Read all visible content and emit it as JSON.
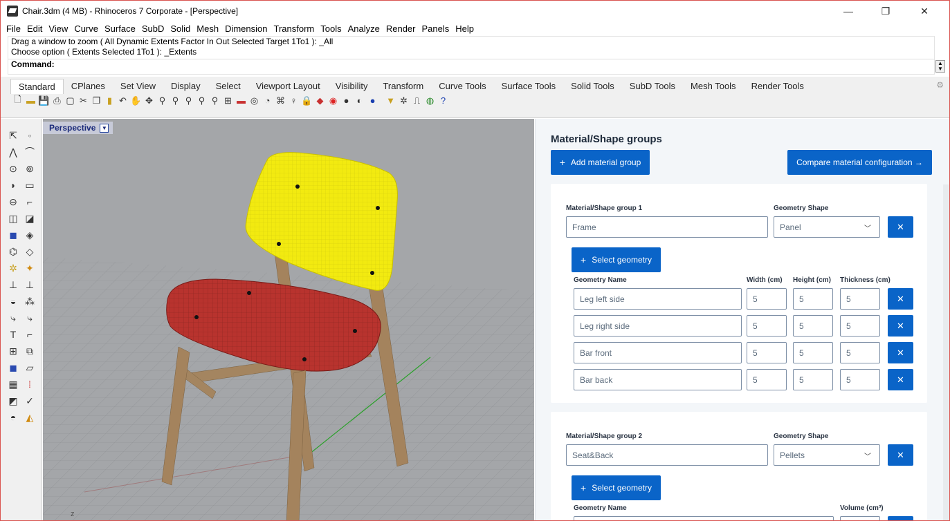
{
  "window": {
    "title": "Chair.3dm (4 MB) - Rhinoceros 7 Corporate - [Perspective]",
    "minimize": "—",
    "restore": "❐",
    "close": "✕"
  },
  "menu": [
    "File",
    "Edit",
    "View",
    "Curve",
    "Surface",
    "SubD",
    "Solid",
    "Mesh",
    "Dimension",
    "Transform",
    "Tools",
    "Analyze",
    "Render",
    "Panels",
    "Help"
  ],
  "command": {
    "history": [
      "Drag a window to zoom ( All  Dynamic  Extents  Factor  In  Out  Selected  Target  1To1 ): _All",
      "Choose option ( Extents  Selected  1To1 ): _Extents"
    ],
    "prompt": "Command:"
  },
  "toolbar_tabs": [
    "Standard",
    "CPlanes",
    "Set View",
    "Display",
    "Select",
    "Viewport Layout",
    "Visibility",
    "Transform",
    "Curve Tools",
    "Surface Tools",
    "Solid Tools",
    "SubD Tools",
    "Mesh Tools",
    "Render Tools"
  ],
  "active_tab": "Standard",
  "toolbar_icons": [
    "new-icon",
    "open-icon",
    "save-icon",
    "print-icon",
    "import-icon",
    "cut-icon",
    "copy-icon",
    "paste-icon",
    "undo-icon",
    "pan-icon",
    "rotate-icon",
    "zoom-icon",
    "zoom-window-icon",
    "zoom-extents-icon",
    "zoom-selected-icon",
    "zoom-all-icon",
    "four-view-icon",
    "car-icon",
    "named-view-icon",
    "cplane-icon",
    "analyze-icon",
    "light-icon",
    "lock-icon",
    "shade-icon",
    "color-wheel-icon",
    "render-sphere-icon",
    "material-icon",
    "blue-sphere-icon",
    "filter-icon",
    "options-icon",
    "grasshopper-icon",
    "globe-icon",
    "help-icon"
  ],
  "viewport": {
    "name": "Perspective",
    "axis_label": "z"
  },
  "panel": {
    "title": "Material/Shape groups",
    "add_group": "Add material group",
    "compare": "Compare material configuration →",
    "groups": [
      {
        "label": "Material/Shape group 1",
        "name": "Frame",
        "shape_label": "Geometry Shape",
        "shape": "Panel",
        "select_geometry": "Select geometry",
        "headers": [
          "Geometry Name",
          "Width (cm)",
          "Height (cm)",
          "Thickness (cm)"
        ],
        "rows": [
          {
            "name": "Leg left side",
            "w": "5",
            "h": "5",
            "t": "5"
          },
          {
            "name": "Leg right side",
            "w": "5",
            "h": "5",
            "t": "5"
          },
          {
            "name": "Bar front",
            "w": "5",
            "h": "5",
            "t": "5"
          },
          {
            "name": "Bar back",
            "w": "5",
            "h": "5",
            "t": "5"
          }
        ]
      },
      {
        "label": "Material/Shape group 2",
        "name": "Seat&Back",
        "shape_label": "Geometry Shape",
        "shape": "Pellets",
        "select_geometry": "Select geometry",
        "headers": [
          "Geometry Name",
          "Volume (cm³)"
        ]
      }
    ],
    "remove_symbol": "✕"
  },
  "colors": {
    "accent": "#0a64c8",
    "seat": "#b8332e",
    "back": "#f2ea10",
    "wood": "#a4835d",
    "viewport_bg": "#a4a6a9"
  }
}
